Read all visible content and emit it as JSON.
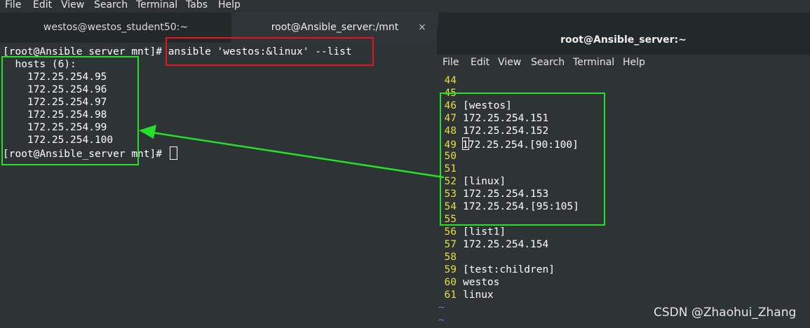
{
  "menubar": {
    "items": [
      "File",
      "Edit",
      "View",
      "Search",
      "Terminal",
      "Tabs",
      "Help"
    ]
  },
  "tabs": [
    {
      "label": "westos@westos_student50:~",
      "active": false
    },
    {
      "label": "root@Ansible_server:/mnt",
      "active": true
    }
  ],
  "tab_close_glyph": "×",
  "main_terminal": {
    "lines": [
      "[root@Ansible_server mnt]# ansible 'westos:&linux' --list",
      "  hosts (6):",
      "    172.25.254.95",
      "    172.25.254.96",
      "    172.25.254.97",
      "    172.25.254.98",
      "    172.25.254.99",
      "    172.25.254.100",
      "[root@Ansible_server mnt]# "
    ]
  },
  "second_window": {
    "title": "root@Ansible_server:~",
    "menu": [
      "File",
      "Edit",
      "View",
      "Search",
      "Terminal",
      "Help"
    ],
    "vim_lines": [
      {
        "n": "44",
        "text": ""
      },
      {
        "n": "45",
        "text": ""
      },
      {
        "n": "46",
        "text": "[westos]"
      },
      {
        "n": "47",
        "text": "172.25.254.151"
      },
      {
        "n": "48",
        "text": "172.25.254.152"
      },
      {
        "n": "49",
        "text": "172.25.254.[90:100]"
      },
      {
        "n": "50",
        "text": ""
      },
      {
        "n": "51",
        "text": ""
      },
      {
        "n": "52",
        "text": "[linux]"
      },
      {
        "n": "53",
        "text": "172.25.254.153"
      },
      {
        "n": "54",
        "text": "172.25.254.[95:105]"
      },
      {
        "n": "55",
        "text": ""
      },
      {
        "n": "56",
        "text": "[list1]"
      },
      {
        "n": "57",
        "text": "172.25.254.154"
      },
      {
        "n": "58",
        "text": ""
      },
      {
        "n": "59",
        "text": "[test:children]"
      },
      {
        "n": "60",
        "text": "westos"
      },
      {
        "n": "61",
        "text": "linux"
      }
    ],
    "tildes": [
      "~",
      "~"
    ]
  },
  "watermark": "CSDN @Zhaohui_Zhang",
  "colors": {
    "terminal_bg": "#2e3436",
    "line_number": "#e8dc3c",
    "highlight_red": "#e8141c",
    "highlight_green": "#25e026",
    "tilde": "#5b7fd6"
  }
}
